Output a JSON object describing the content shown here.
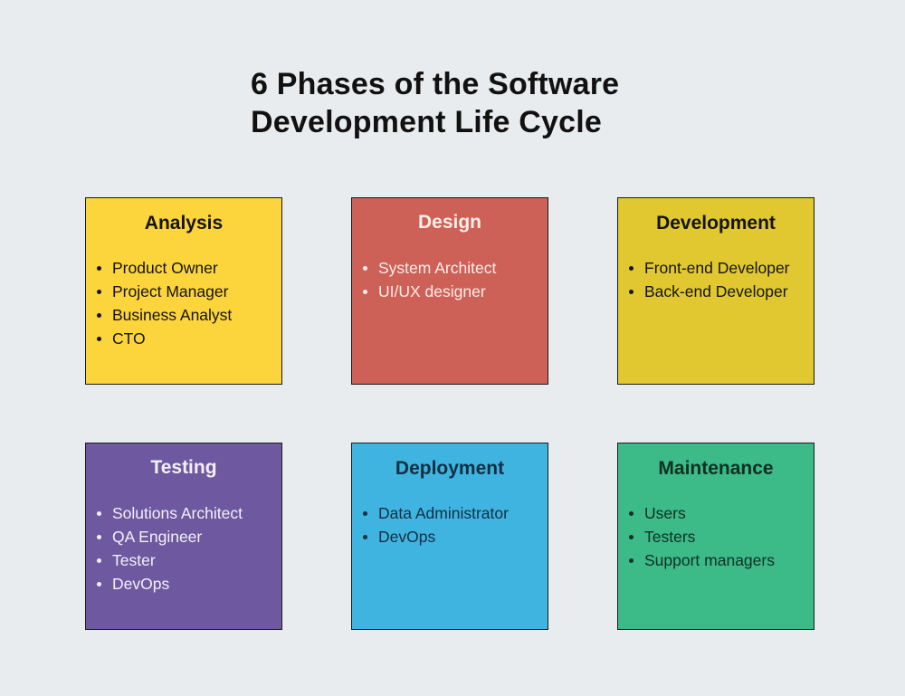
{
  "title": {
    "line1": "6 Phases of the Software",
    "line2": "Development Life Cycle"
  },
  "phases": [
    {
      "name": "Analysis",
      "bg": "#fcd43c",
      "text_color": "#141414",
      "roles": [
        "Product Owner",
        "Project Manager",
        "Business Analyst",
        "CTO"
      ]
    },
    {
      "name": "Design",
      "bg": "#cd6158",
      "text_color": "#fbeee9",
      "roles": [
        "System Architect",
        "UI/UX designer"
      ]
    },
    {
      "name": "Development",
      "bg": "#e1c830",
      "text_color": "#141414",
      "roles": [
        "Front-end Developer",
        "Back-end Developer"
      ]
    },
    {
      "name": "Testing",
      "bg": "#6e58a0",
      "text_color": "#f4f0fb",
      "roles": [
        "Solutions Architect",
        "QA Engineer",
        "Tester",
        "DevOps"
      ]
    },
    {
      "name": "Deployment",
      "bg": "#40b4e0",
      "text_color": "#0f2f43",
      "roles": [
        "Data Administrator",
        "DevOps"
      ]
    },
    {
      "name": "Maintenance",
      "bg": "#3cba88",
      "text_color": "#0f2f22",
      "roles": [
        "Users",
        "Testers",
        "Support managers"
      ]
    }
  ]
}
